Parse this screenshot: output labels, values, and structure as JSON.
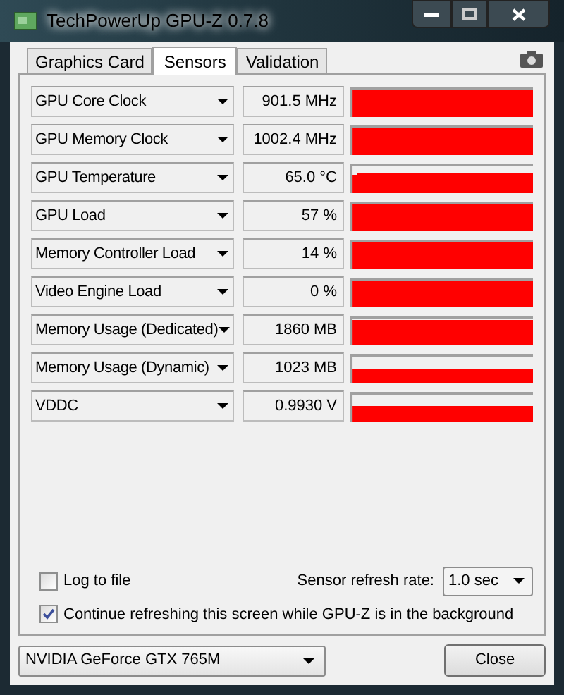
{
  "window": {
    "title": "TechPowerUp GPU-Z 0.7.8"
  },
  "tabs": [
    {
      "label": "Graphics Card",
      "selected": false
    },
    {
      "label": "Sensors",
      "selected": true
    },
    {
      "label": "Validation",
      "selected": false
    }
  ],
  "sensors": [
    {
      "name": "GPU Core Clock",
      "value": "901.5 MHz"
    },
    {
      "name": "GPU Memory Clock",
      "value": "1002.4 MHz"
    },
    {
      "name": "GPU Temperature",
      "value": "65.0 °C"
    },
    {
      "name": "GPU Load",
      "value": "57 %"
    },
    {
      "name": "Memory Controller Load",
      "value": "14 %"
    },
    {
      "name": "Video Engine Load",
      "value": "0 %"
    },
    {
      "name": "Memory Usage (Dedicated)",
      "value": "1860 MB"
    },
    {
      "name": "Memory Usage (Dynamic)",
      "value": "1023 MB"
    },
    {
      "name": "VDDC",
      "value": "0.9930 V"
    }
  ],
  "log_to_file": {
    "label": "Log to file",
    "checked": false
  },
  "refresh": {
    "label": "Sensor refresh rate:",
    "value": "1.0 sec"
  },
  "continue_refreshing": {
    "label": "Continue refreshing this screen while GPU-Z is in the background",
    "checked": true
  },
  "device": {
    "value": "NVIDIA GeForce GTX 765M"
  },
  "buttons": [
    "Close"
  ]
}
